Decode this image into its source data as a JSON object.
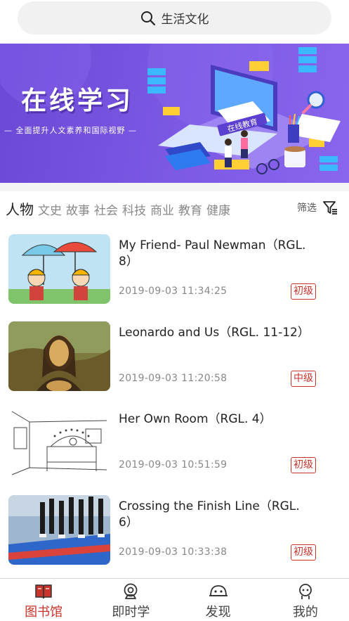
{
  "search": {
    "text": "生活文化"
  },
  "banner": {
    "title": "在线学习",
    "subtitle": "— 全面提升人文素养和国际视野 —",
    "sign": "在线教育"
  },
  "categories": {
    "items": [
      "人物",
      "文史",
      "故事",
      "社会",
      "科技",
      "商业",
      "教育",
      "健康"
    ],
    "active": "人物"
  },
  "filter": {
    "label": "筛选"
  },
  "articles": [
    {
      "title": "My Friend- Paul Newman（RGL. 8）",
      "date": "2019-09-03 11:34:25",
      "level": "初级",
      "thumb": "cartoon-umbrella"
    },
    {
      "title": "Leonardo and Us（RGL. 11-12）",
      "date": "2019-09-03 11:20:58",
      "level": "中级",
      "thumb": "mona-lisa"
    },
    {
      "title": "Her Own Room（RGL. 4）",
      "date": "2019-09-03 10:51:59",
      "level": "初级",
      "thumb": "room-sketch"
    },
    {
      "title": "Crossing the Finish Line（RGL. 6）",
      "date": "2019-09-03 10:33:38",
      "level": "初级",
      "thumb": "marathon"
    }
  ],
  "tabbar": {
    "tabs": [
      {
        "label": "图书馆",
        "icon": "book-icon",
        "active": true
      },
      {
        "label": "即时学",
        "icon": "webcam-icon",
        "active": false
      },
      {
        "label": "发现",
        "icon": "discover-face-icon",
        "active": false
      },
      {
        "label": "我的",
        "icon": "profile-icon",
        "active": false
      }
    ]
  },
  "colors": {
    "accent": "#c8332b",
    "banner": "#7a57e2",
    "search_bg": "#f1f1f1"
  }
}
